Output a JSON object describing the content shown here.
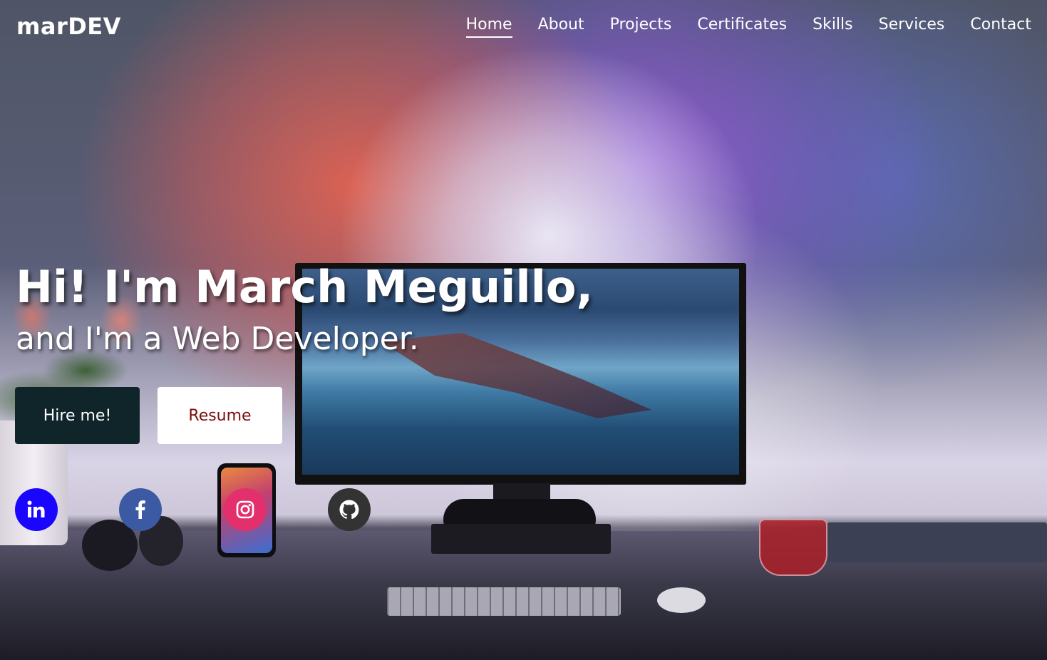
{
  "brand": {
    "logo": "marDEV"
  },
  "nav": {
    "items": [
      {
        "label": "Home",
        "active": true
      },
      {
        "label": "About"
      },
      {
        "label": "Projects"
      },
      {
        "label": "Certificates"
      },
      {
        "label": "Skills"
      },
      {
        "label": "Services"
      },
      {
        "label": "Contact"
      }
    ]
  },
  "hero": {
    "headline": "Hi! I'm March Meguillo,",
    "subline": "and I'm a Web Developer.",
    "hire_label": "Hire me!",
    "resume_label": "Resume"
  },
  "social": [
    {
      "icon": "linkedin-icon",
      "color": "#1a05ff"
    },
    {
      "icon": "facebook-icon",
      "color": "#3b5aa3"
    },
    {
      "icon": "instagram-icon",
      "color": "#e3306c"
    },
    {
      "icon": "github-icon",
      "color": "#333333"
    }
  ],
  "colors": {
    "hire_bg": "#10252a",
    "resume_text": "#7a0d0d",
    "text": "#ffffff"
  }
}
